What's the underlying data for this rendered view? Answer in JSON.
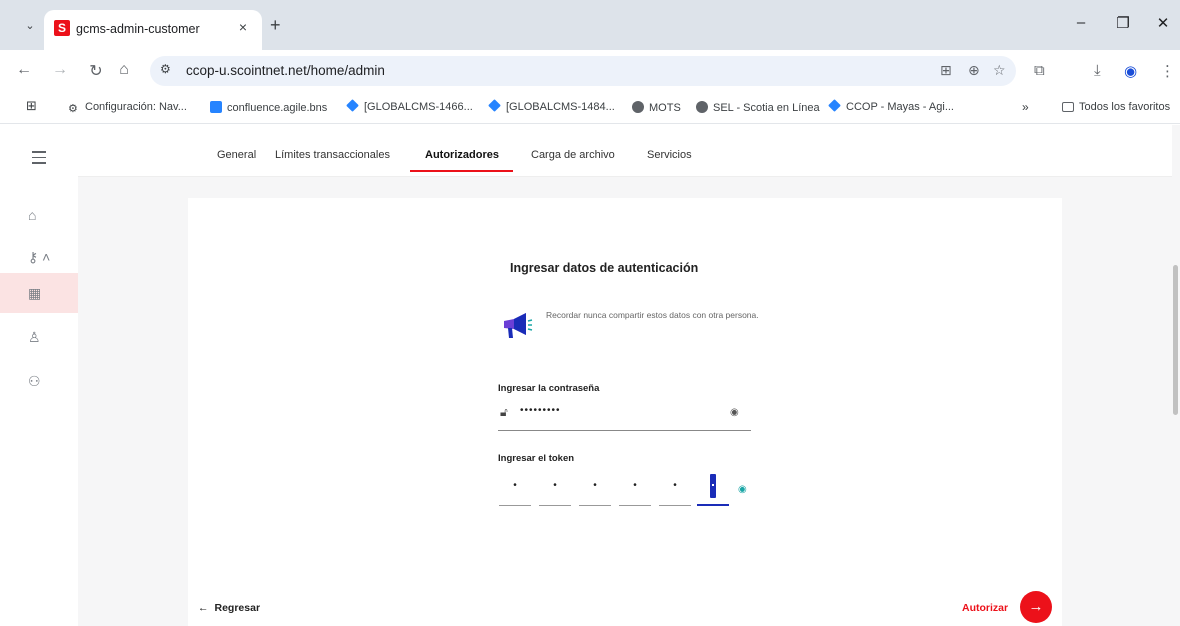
{
  "browser": {
    "tab_title": "gcms-admin-customer",
    "tab_favicon": "S",
    "tab_close": "×",
    "new_tab": "+",
    "url": "ccop-u.scointnet.net/home/admin",
    "window_controls": {
      "minimize": "–",
      "restore": "❐",
      "close": "✕"
    }
  },
  "bookmarks": [
    {
      "label": "Configuración: Nav...",
      "icon": "gear-icon"
    },
    {
      "label": "confluence.agile.bns",
      "icon": "confluence-icon"
    },
    {
      "label": "[GLOBALCMS-1466...",
      "icon": "jira-icon"
    },
    {
      "label": "[GLOBALCMS-1484...",
      "icon": "jira-icon"
    },
    {
      "label": "MOTS",
      "icon": "globe-icon"
    },
    {
      "label": "SEL - Scotia en Línea",
      "icon": "globe-icon"
    },
    {
      "label": "CCOP - Mayas - Agi...",
      "icon": "jira-icon"
    }
  ],
  "bookmarks_more": "»",
  "all_bookmarks": "Todos los favoritos",
  "app_tabs": [
    {
      "label": "General",
      "active": false
    },
    {
      "label": "Límites transaccionales",
      "active": false
    },
    {
      "label": "Autorizadores",
      "active": true
    },
    {
      "label": "Carga de archivo",
      "active": false
    },
    {
      "label": "Servicios",
      "active": false
    }
  ],
  "auth": {
    "title": "Ingresar datos de autenticación",
    "notice": "Recordar nunca compartir estos datos con otra persona.",
    "password_label": "Ingresar la contraseña",
    "password_value": "•••••••••",
    "token_label": "Ingresar el token",
    "token_digits": [
      "•",
      "•",
      "•",
      "•",
      "•",
      "•"
    ]
  },
  "footer": {
    "back_label": "Regresar",
    "authorize_label": "Autorizar"
  },
  "colors": {
    "accent": "#ec111a",
    "token_active": "#1a2cb8"
  }
}
